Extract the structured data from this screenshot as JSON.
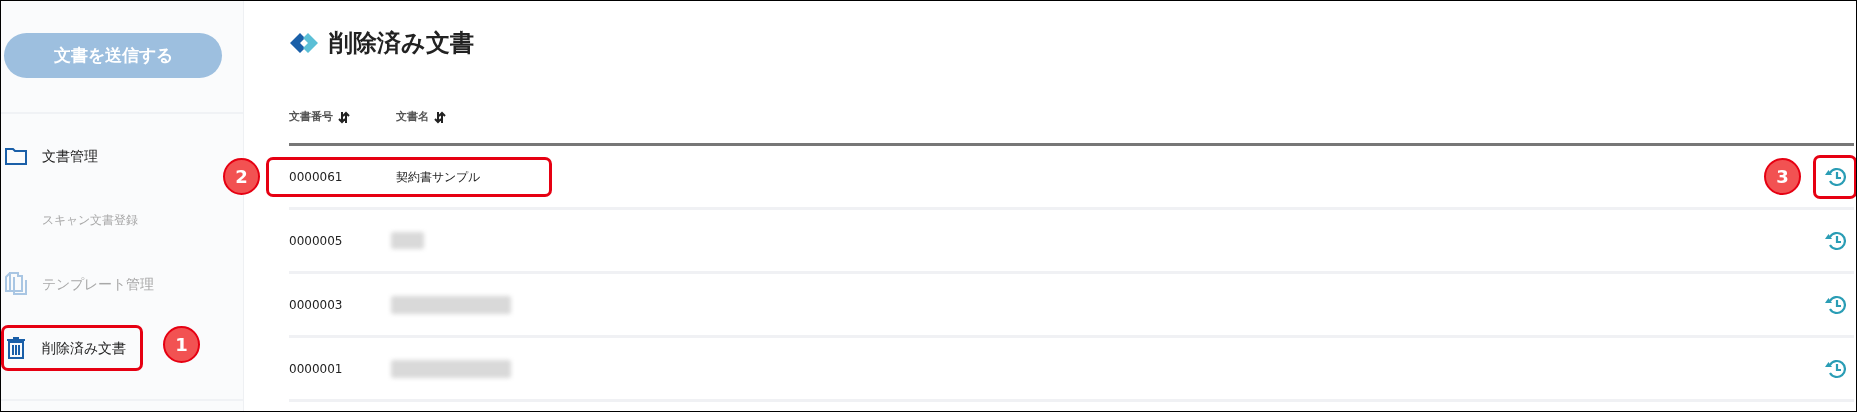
{
  "sidebar": {
    "send_button": {
      "label": "文書を送信する",
      "disabled": true
    },
    "items": [
      {
        "kind": "main",
        "label": "文書管理",
        "disabled": false,
        "highlighted": false
      },
      {
        "kind": "sub",
        "label": "スキャン文書登録",
        "disabled": true,
        "highlighted": false
      },
      {
        "kind": "main",
        "label": "テンプレート管理",
        "disabled": true,
        "highlighted": false
      },
      {
        "kind": "main",
        "label": "削除済み文書",
        "disabled": false,
        "highlighted": true
      }
    ]
  },
  "page": {
    "title": "削除済み文書"
  },
  "table": {
    "columns": [
      "文書番号",
      "文書名"
    ],
    "rows": [
      {
        "number": "0000061",
        "name": "契約書サンプル",
        "highlighted": true,
        "restore_highlighted": true
      },
      {
        "number": "0000005",
        "redacted": true,
        "highlighted": false,
        "restore_highlighted": false
      },
      {
        "number": "0000003",
        "redacted": true,
        "highlighted": false,
        "restore_highlighted": false
      },
      {
        "number": "0000001",
        "redacted": true,
        "highlighted": false,
        "restore_highlighted": false
      }
    ]
  },
  "callouts": [
    {
      "number": "1"
    },
    {
      "number": "2"
    },
    {
      "number": "3"
    }
  ]
}
